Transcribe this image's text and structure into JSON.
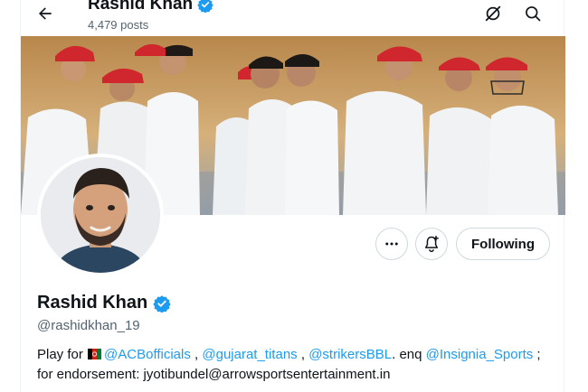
{
  "header": {
    "title": "Rashid Khan",
    "posts_count": "4,479 posts"
  },
  "profile": {
    "name": "Rashid Khan",
    "handle": "@rashidkhan_19",
    "following_label": "Following",
    "verified_color": "#1d9bf0"
  },
  "bio": {
    "prefix": "Play for ",
    "mention_1": "@ACBofficials",
    "sep_1": " , ",
    "mention_2": "@gujarat_titans",
    "sep_2": " ,  ",
    "mention_3": "@strikersBBL",
    "sep_3": ". enq ",
    "mention_4": "@Insignia_Sports",
    "sep_4": " ;",
    "line_2": "for endorsement: jyotibundel@arrowsportsentertainment.in"
  },
  "icons": {
    "back": "arrow-left-icon",
    "grok": "grok-slash-icon",
    "search": "search-icon",
    "more": "more-dots-icon",
    "notify": "bell-plus-icon",
    "verified": "verified-badge-icon",
    "flag": "afghanistan-flag-icon"
  },
  "colors": {
    "accent": "#1d9bf0",
    "text": "#0f1419",
    "secondary": "#536471",
    "border": "#cfd9de"
  }
}
